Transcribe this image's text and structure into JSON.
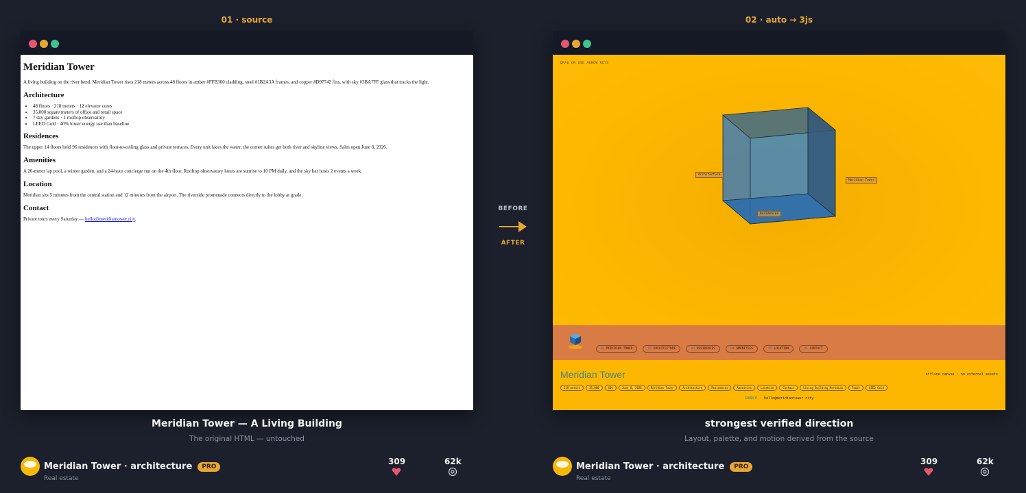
{
  "source_panel": {
    "heading": "01 · source",
    "doc": {
      "title": "Meridian Tower",
      "intro": "A living building on the river bend. Meridian Tower rises 218 meters across 48 floors in amber #FFB300 cladding, steel #1B2A3A frames, and copper #D97742 fins, with sky #3BA7FF glass that tracks the light.",
      "sections": {
        "architecture": {
          "title": "Architecture",
          "items": [
            "48 floors · 218 meters · 12 elevator cores",
            "35,000 square meters of office and retail space",
            "7 sky gardens · 1 rooftop observatory",
            "LEED Gold · 40% lower energy use than baseline"
          ]
        },
        "residences": {
          "title": "Residences",
          "text": "The upper 14 floors hold 96 residences with floor-to-ceiling glass and private terraces. Every unit faces the water; the corner suites get both river and skyline views. Sales open June 8, 2026."
        },
        "amenities": {
          "title": "Amenities",
          "text": "A 20-meter lap pool, a winter garden, and a 24-hour concierge run on the 4th floor. Rooftop observatory hours are sunrise to 10 PM daily, and the sky bar hosts 2 events a week."
        },
        "location": {
          "title": "Location",
          "text": "Meridian sits 5 minutes from the central station and 12 minutes from the airport. The riverside promenade connects directly to the lobby at grade."
        },
        "contact": {
          "title": "Contact",
          "text": "Private tours every Saturday — ",
          "email": "hello@meridiantower.city",
          "end": "."
        }
      }
    },
    "caption": "Meridian Tower — A Living Building",
    "subcaption": "The original HTML — untouched"
  },
  "middle": {
    "before": "BEFORE",
    "after": "AFTER"
  },
  "result_panel": {
    "heading": "02 · auto → 3js",
    "hint": "DRAG OR USE ARROW KEYS",
    "labels": {
      "architecture": "Architecture",
      "tower": "Meridian Tower",
      "residences": "Residences"
    },
    "nav": [
      {
        "num": "01",
        "label": "MERIDIAN TOWER"
      },
      {
        "num": "02",
        "label": "ARCHITECTURE"
      },
      {
        "num": "03",
        "label": "RESIDENCES"
      },
      {
        "num": "04",
        "label": "AMENITIES"
      },
      {
        "num": "05",
        "label": "LOCATION"
      },
      {
        "num": "06",
        "label": "CONTACT"
      }
    ],
    "footer_title": "Meridian Tower",
    "offline": "offline canvas · no external assets",
    "chips": [
      "218 meters",
      "35,000",
      "40%",
      "June 8, 2026",
      "Meridian Tower",
      "Architecture",
      "Residences",
      "Amenities",
      "Location",
      "Contact",
      "Living Building Meridian",
      "Tower",
      "LEED Gold"
    ],
    "source_label": "SOURCE",
    "email": "hello@meridiantower.city",
    "caption": "strongest verified direction",
    "subcaption": "Layout, palette, and motion derived from the source"
  },
  "author": {
    "name": "Meridian Tower · architecture",
    "badge": "PRO",
    "category": "Real estate",
    "likes": "309",
    "views": "62k"
  },
  "colors": {
    "background": "#1b202c",
    "accent": "#e8a732",
    "amber": "#FFB300",
    "copper": "#D97742",
    "sky": "#3BA7FF",
    "steel": "#1B2A3A"
  }
}
